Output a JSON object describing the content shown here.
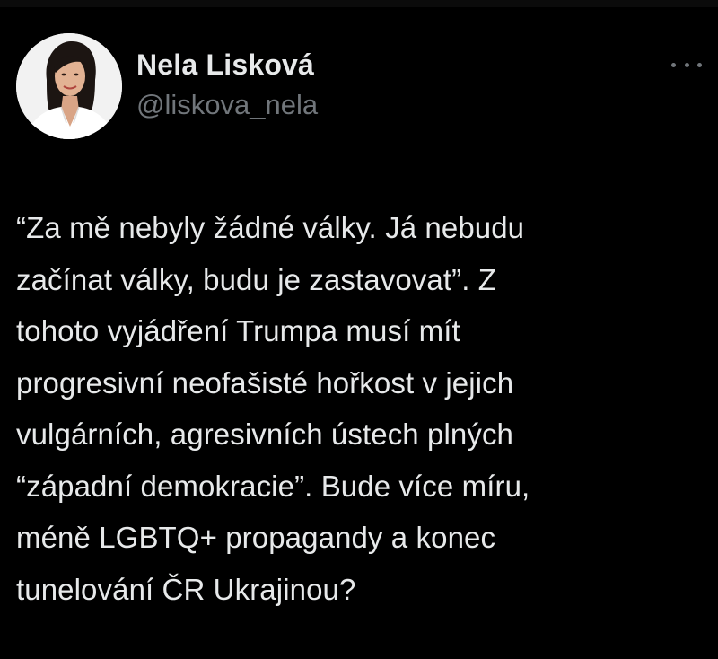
{
  "tweet": {
    "author": {
      "display_name": "Nela Lisková",
      "handle": "@liskova_nela"
    },
    "more_menu_icon": "more-horizontal-icon",
    "text_lines": [
      "“Za mě nebyly žádné války. Já nebudu",
      "začínat války, budu je zastavovat”. Z",
      "tohoto vyjádření Trumpa musí mít",
      "progresivní neofašisté hořkost v jejich",
      "vulgárních, agresivních ústech plných",
      "“západní demokracie”. Bude více míru,",
      "méně LGBTQ+ propagandy a konec",
      "tunelování ČR Ukrajinou?"
    ]
  },
  "colors": {
    "background": "#000000",
    "primary_text": "#e7e9ea",
    "secondary_text": "#71767b"
  }
}
